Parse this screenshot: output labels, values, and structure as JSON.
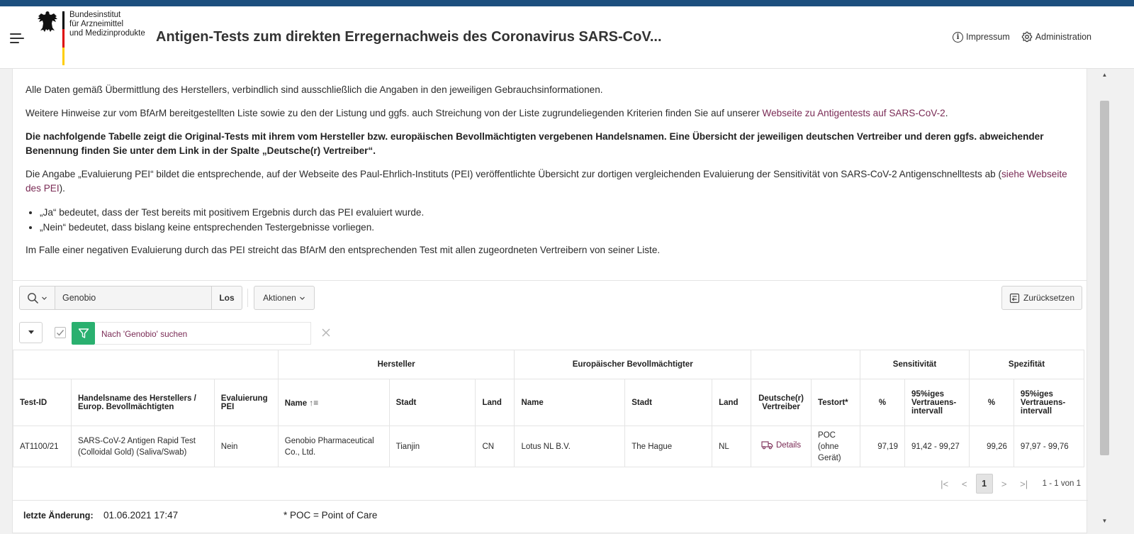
{
  "header": {
    "org_lines": [
      "Bundesinstitut",
      "für Arzneimittel",
      "und Medizinprodukte"
    ],
    "title": "Antigen-Tests zum direkten Erregernachweis des Coronavirus SARS-CoV...",
    "links": {
      "impressum": "Impressum",
      "administration": "Administration"
    },
    "flag_colors": [
      "#000000",
      "#dd0000",
      "#ffce00"
    ]
  },
  "info": {
    "p1": "Alle Daten gemäß Übermittlung des Herstellers, verbindlich sind ausschließlich die Angaben in den jeweiligen Gebrauchsinformationen.",
    "p2_text": "Weitere Hinweise zur vom BfArM bereitgestellten Liste sowie zu den der Listung und ggfs. auch Streichung von der Liste zugrundeliegenden Kriterien finden Sie auf unserer ",
    "p2_link": "Webseite zu Antigentests auf SARS-CoV-2",
    "p2_end": ".",
    "p3_bold": "Die nachfolgende Tabelle zeigt die Original-Tests mit ihrem vom Hersteller bzw. europäischen Bevollmächtigten vergebenen Handelsnamen. Eine Übersicht der jeweiligen deutschen Vertreiber und deren ggfs. abweichender Benennung finden Sie unter dem Link in der Spalte „Deutsche(r) Vertreiber“.",
    "p4_text": "Die Angabe „Evaluierung PEI“ bildet die entsprechende, auf der Webseite des Paul-Ehrlich-Instituts (PEI) veröffentlichte Übersicht zur dortigen vergleichenden Evaluierung der Sensitivität von SARS-CoV-2 Antigenschnelltests ab (",
    "p4_link": "siehe Webseite des PEI",
    "p4_end": ").",
    "bullet1": "„Ja“ bedeutet, dass der Test bereits mit positivem Ergebnis durch das PEI evaluiert wurde.",
    "bullet2": "„Nein“ bedeutet, dass bislang keine entsprechenden Testergebnisse vorliegen.",
    "p5": "Im Falle einer negativen Evaluierung durch das PEI streicht das BfArM den entsprechenden Test mit allen zugeordneten Vertreibern von seiner Liste."
  },
  "toolbar": {
    "search_value": "Genobio",
    "go_label": "Los",
    "actions_label": "Aktionen",
    "reset_label": "Zurücksetzen"
  },
  "filter": {
    "text": "Nach 'Genobio' suchen",
    "accent_color": "#2ab06f"
  },
  "table": {
    "groups": {
      "hersteller": "Hersteller",
      "bevollmaechtigter": "Europäischer Bevollmächtigter",
      "sensitivitaet": "Sensitivität",
      "spezifitaet": "Spezifität"
    },
    "columns": {
      "test_id": "Test-ID",
      "handelsname": "Handelsname des Herstellers / Europ. Bevollmächtigten",
      "evaluierung": "Evaluierung PEI",
      "h_name": "Name",
      "h_stadt": "Stadt",
      "h_land": "Land",
      "b_name": "Name",
      "b_stadt": "Stadt",
      "b_land": "Land",
      "vertreiber": "Deutsche(r) Vertreiber",
      "testort": "Testort*",
      "sens_pct": "%",
      "sens_ci": "95%iges Vertrauens-intervall",
      "spez_pct": "%",
      "spez_ci": "95%iges Vertrauens-intervall"
    },
    "rows": [
      {
        "test_id": "AT1100/21",
        "handelsname": "SARS-CoV-2 Antigen Rapid Test (Colloidal Gold) (Saliva/Swab)",
        "evaluierung": "Nein",
        "h_name": "Genobio Pharmaceutical Co., Ltd.",
        "h_stadt": "Tianjin",
        "h_land": "CN",
        "b_name": "Lotus NL B.V.",
        "b_stadt": "The Hague",
        "b_land": "NL",
        "vertreiber": "Details",
        "testort": "POC (ohne Gerät)",
        "sens_pct": "97,19",
        "sens_ci": "91,42 - 99,27",
        "spez_pct": "99,26",
        "spez_ci": "97,97 - 99,76"
      }
    ]
  },
  "pagination": {
    "current": "1",
    "info": "1 - 1 von 1"
  },
  "footer": {
    "lastchange_label": "letzte Änderung:",
    "lastchange_value": "01.06.2021 17:47",
    "poc_note": "* POC = Point of Care"
  },
  "colors": {
    "link": "#7a2b55",
    "topbar": "#1d4f7e"
  }
}
